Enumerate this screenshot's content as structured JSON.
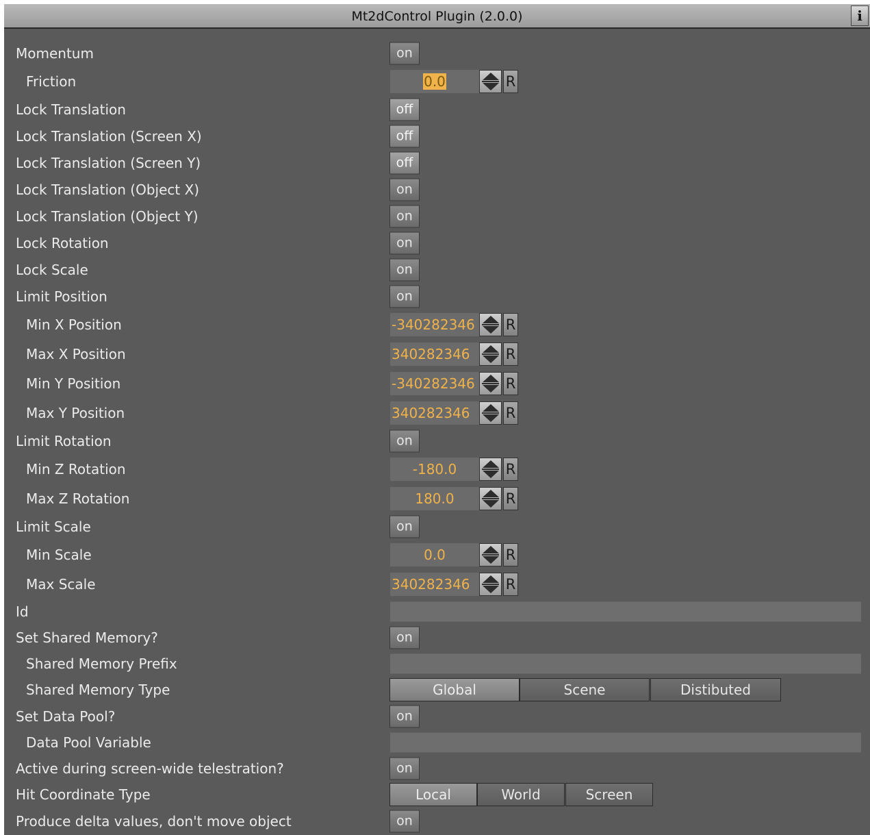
{
  "window": {
    "title": "Mt2dControl Plugin (2.0.0)",
    "info_label": "i"
  },
  "rows": {
    "momentum": {
      "label": "Momentum",
      "value": "on"
    },
    "friction": {
      "label": "Friction",
      "value": "0.0"
    },
    "lock_translation": {
      "label": "Lock Translation",
      "value": "off"
    },
    "lock_translation_screen_x": {
      "label": "Lock Translation (Screen X)",
      "value": "off"
    },
    "lock_translation_screen_y": {
      "label": "Lock Translation (Screen Y)",
      "value": "off"
    },
    "lock_translation_object_x": {
      "label": "Lock Translation (Object X)",
      "value": "on"
    },
    "lock_translation_object_y": {
      "label": "Lock Translation (Object Y)",
      "value": "on"
    },
    "lock_rotation": {
      "label": "Lock Rotation",
      "value": "on"
    },
    "lock_scale": {
      "label": "Lock Scale",
      "value": "on"
    },
    "limit_position": {
      "label": "Limit Position",
      "value": "on"
    },
    "min_x_position": {
      "label": "Min X Position",
      "value": "-340282346"
    },
    "max_x_position": {
      "label": "Max X Position",
      "value": "340282346"
    },
    "min_y_position": {
      "label": "Min Y Position",
      "value": "-340282346"
    },
    "max_y_position": {
      "label": "Max Y Position",
      "value": "340282346"
    },
    "limit_rotation": {
      "label": "Limit Rotation",
      "value": "on"
    },
    "min_z_rotation": {
      "label": "Min Z Rotation",
      "value": "-180.0"
    },
    "max_z_rotation": {
      "label": "Max Z Rotation",
      "value": "180.0"
    },
    "limit_scale": {
      "label": "Limit Scale",
      "value": "on"
    },
    "min_scale": {
      "label": "Min Scale",
      "value": "0.0"
    },
    "max_scale": {
      "label": "Max Scale",
      "value": "340282346"
    },
    "id": {
      "label": "Id",
      "value": ""
    },
    "set_shared_memory": {
      "label": "Set Shared Memory?",
      "value": "on"
    },
    "shared_memory_prefix": {
      "label": "Shared Memory Prefix",
      "value": ""
    },
    "shared_memory_type": {
      "label": "Shared Memory Type",
      "options": [
        "Global",
        "Scene",
        "Distibuted"
      ],
      "selected": "Global"
    },
    "set_data_pool": {
      "label": "Set Data Pool?",
      "value": "on"
    },
    "data_pool_variable": {
      "label": "Data Pool Variable",
      "value": ""
    },
    "active_during_telestration": {
      "label": "Active during screen-wide telestration?",
      "value": "on"
    },
    "hit_coordinate_type": {
      "label": "Hit Coordinate Type",
      "options": [
        "Local",
        "World",
        "Screen"
      ],
      "selected": "Local"
    },
    "produce_delta_values": {
      "label": "Produce delta values, don't move object",
      "value": "on"
    }
  },
  "reset_label": "R",
  "colors": {
    "panel": "#5a5a5a",
    "value_text": "#f0b24a",
    "title_bar": "#b0b0b0"
  }
}
